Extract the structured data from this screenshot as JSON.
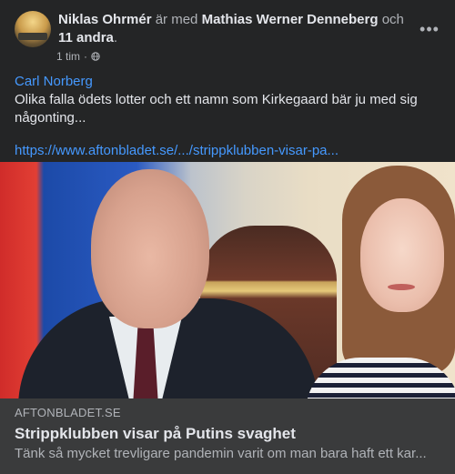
{
  "post": {
    "author": "Niklas Ohrmér",
    "with_text": "är med",
    "tagged_person": "Mathias Werner Denneberg",
    "and_text": "och",
    "others": "11 andra",
    "period": ".",
    "time": "1 tim",
    "dot": "·",
    "privacy_icon": "globe-icon",
    "more_icon": "more-options-icon",
    "mention": "Carl Norberg",
    "body": "Olika falla ödets lotter och ett namn som Kirkegaard bär ju med sig någonting...",
    "url": "https://www.aftonbladet.se/.../strippklubben-visar-pa..."
  },
  "link_preview": {
    "domain": "AFTONBLADET.SE",
    "title": "Strippklubben visar på Putins svaghet",
    "description": "Tänk så mycket trevligare pandemin varit om man bara haft ett kar..."
  },
  "colors": {
    "card_bg": "#242526",
    "link_blue": "#4599ff",
    "preview_bg": "#3a3b3c"
  }
}
